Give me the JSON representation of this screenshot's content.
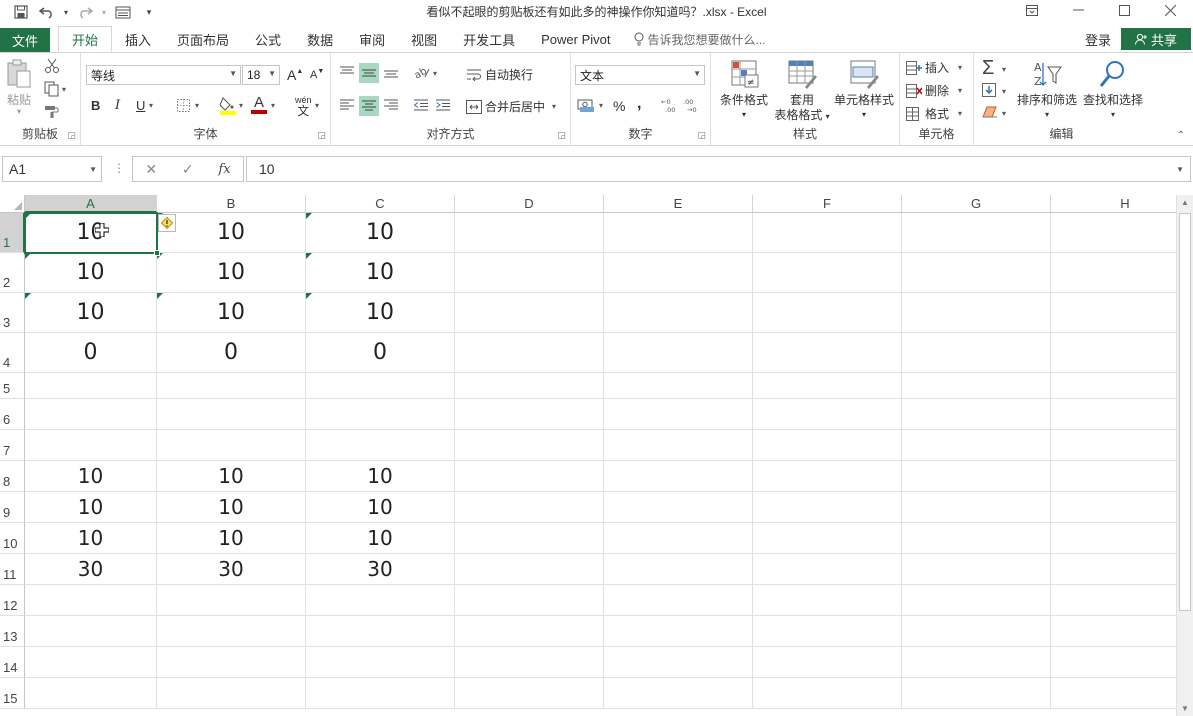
{
  "window": {
    "title": "看似不起眼的剪贴板还有如此多的神操作你知道吗？.xlsx - Excel"
  },
  "tabs": {
    "file": "文件",
    "items": [
      "开始",
      "插入",
      "页面布局",
      "公式",
      "数据",
      "审阅",
      "视图",
      "开发工具",
      "Power Pivot"
    ],
    "active": "开始",
    "tell_me": "告诉我您想要做什么...",
    "login": "登录",
    "share": "共享"
  },
  "ribbon": {
    "clipboard": {
      "label": "剪贴板",
      "paste": "粘贴"
    },
    "font": {
      "label": "字体",
      "name": "等线",
      "size": "18",
      "bold": "B",
      "italic": "I",
      "underline": "U",
      "phonetic": "wén",
      "font_color_letter": "A",
      "grow": "A",
      "shrink": "A"
    },
    "alignment": {
      "label": "对齐方式",
      "wrap": "自动换行",
      "merge": "合并后居中"
    },
    "number": {
      "label": "数字",
      "format": "文本",
      "percent": "%",
      "comma": ",",
      "inc_decimal": "←0 .00",
      "dec_decimal": ".00 →0"
    },
    "styles": {
      "label": "样式",
      "conditional": "条件格式",
      "table_line1": "套用",
      "table_line2": "表格格式",
      "cell_styles": "单元格样式"
    },
    "cells": {
      "label": "单元格",
      "insert": "插入",
      "delete": "删除",
      "format": "格式"
    },
    "editing": {
      "label": "编辑",
      "sort": "排序和筛选",
      "find": "查找和选择"
    }
  },
  "formula_bar": {
    "name_box": "A1",
    "cancel": "✕",
    "enter": "✓",
    "fx": "fx",
    "content": "10"
  },
  "grid": {
    "columns": [
      "A",
      "B",
      "C",
      "D",
      "E",
      "F",
      "G",
      "H"
    ],
    "rows": [
      "1",
      "2",
      "3",
      "4",
      "5",
      "6",
      "7",
      "8",
      "9",
      "10",
      "11",
      "12",
      "13",
      "14",
      "15"
    ],
    "cells": {
      "r1": [
        "10",
        "10",
        "10"
      ],
      "r2": [
        "10",
        "10",
        "10"
      ],
      "r3": [
        "10",
        "10",
        "10"
      ],
      "r4": [
        "0",
        "0",
        "0"
      ],
      "r8": [
        "10",
        "10",
        "10"
      ],
      "r9": [
        "10",
        "10",
        "10"
      ],
      "r10": [
        "10",
        "10",
        "10"
      ],
      "r11": [
        "30",
        "30",
        "30"
      ]
    },
    "selected_cell": "A1"
  },
  "colors": {
    "accent": "#217346",
    "selection_fill": "#d2d2d2",
    "align_highlight": "#a8d8c0"
  }
}
